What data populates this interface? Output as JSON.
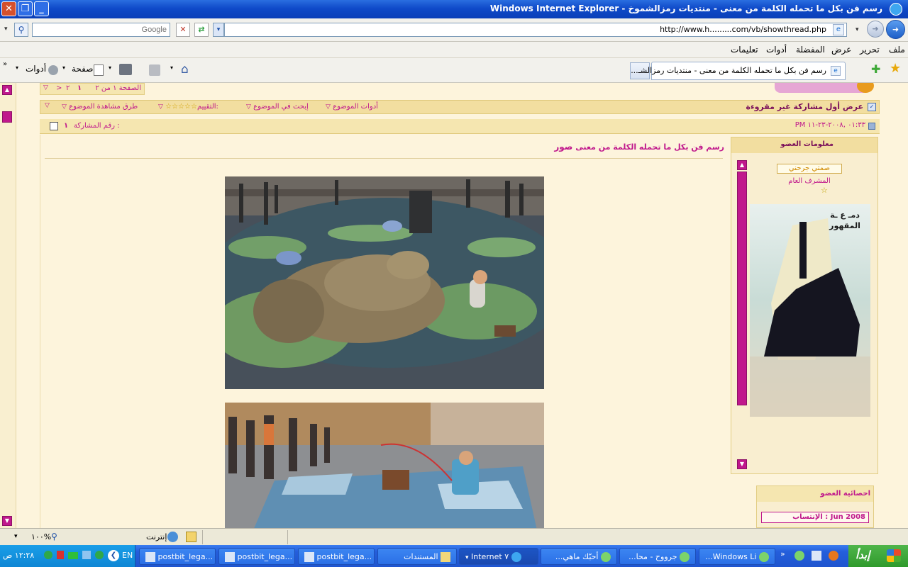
{
  "window": {
    "title": "رسم فن بكل ما تحمله الكلمة من معنى - منتديات رمزالشموخ - Windows Internet Explorer"
  },
  "toolbar": {
    "search_placeholder": "Google",
    "address_value": "http://www.h.........com/vb/showthread.php"
  },
  "menu": {
    "items": [
      "ملف",
      "تحرير",
      "عرض",
      "المفضلة",
      "أدوات",
      "تعليمات"
    ]
  },
  "commands": {
    "tab_title": "رسم فن بكل ما تحمله الكلمة من معنى - منتديات رمزالشـ...",
    "page_label": "صفحة",
    "tools_label": "أدوات"
  },
  "thread": {
    "pagination": {
      "label": "الصفحة ١ من ٢",
      "pages": [
        "١",
        "٢"
      ],
      "next": ">"
    },
    "first_unread": "عرض أول مشاركة غير مقروءة",
    "options": {
      "tools": "أدوات الموضوع",
      "search": "إبحث في الموضوع",
      "rating": "التقييم:",
      "display": "طرق مشاهدة الموضوع"
    },
    "post_date": "PM ٠١:٣٣ ,٢٠٠٨-٢٣-١١",
    "post_number_label": "رقم المشاركة :",
    "post_number": "١",
    "post_title_prefix": "صور",
    "post_title": "رسم فن بكل ما تحمله الكلمة من معنى"
  },
  "member": {
    "header": "معلومات العضو",
    "name": "صمتي جرحني",
    "rank": "المشرف العام",
    "avatar_text": "دمـ ع ـة المقهور",
    "stats_header": "احصائية العضو",
    "joined": "الإنتساب : Jun 2008"
  },
  "status": {
    "zone": "إنترنت",
    "zoom": "١٠٠%"
  },
  "taskbar": {
    "start": "إبدأ",
    "tasks": [
      "Windows Li...",
      "جرووح - محا...",
      "أحبّك ماهي...",
      "Internet ٧",
      "المستندات",
      "postbit_lega...",
      "postbit_lega...",
      "postbit_lega..."
    ],
    "lang": "EN",
    "clock": "١٢:٢٨ ص"
  },
  "colors": {
    "accent_pink": "#c0188c",
    "forum_gold": "#f5e6b0",
    "page_bg": "#fdf4dc"
  }
}
